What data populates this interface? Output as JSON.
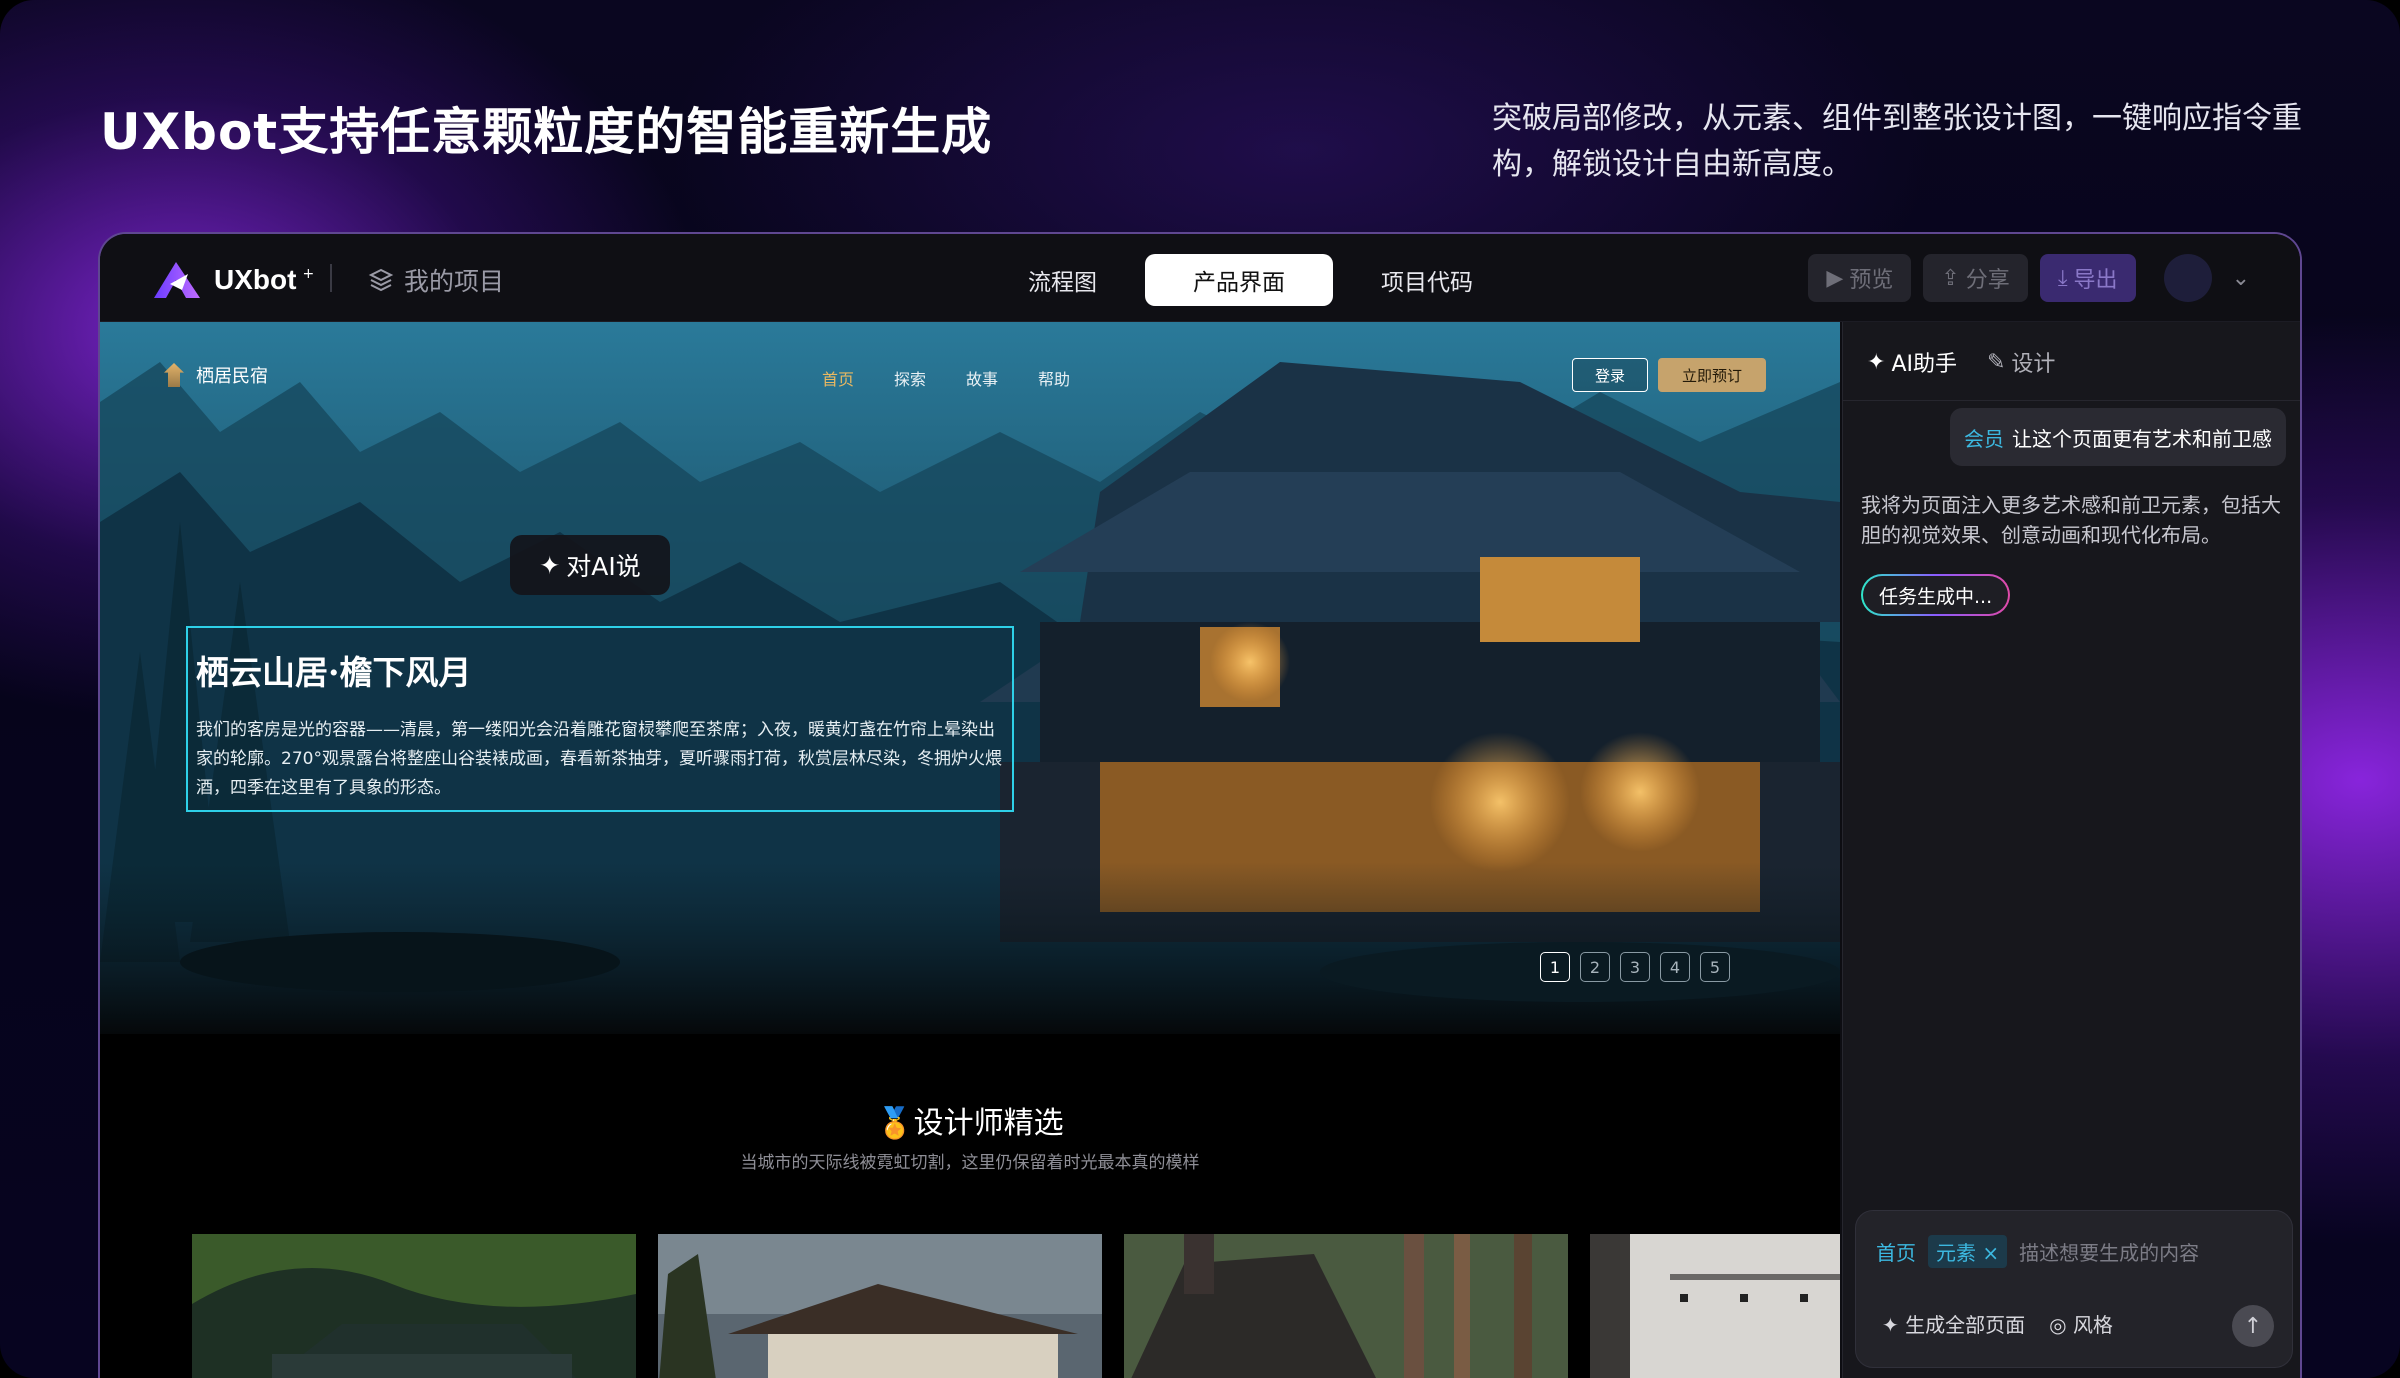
{
  "headline": "UXbot支持任意颗粒度的智能重新生成",
  "subline": "突破局部修改，从元素、组件到整张设计图，一键响应指令重构，解锁设计自由新高度。",
  "app": {
    "logo_text": "UXbot",
    "logo_sup": "+",
    "my_projects": "我的项目",
    "tabs": [
      "流程图",
      "产品界面",
      "项目代码"
    ],
    "active_tab": "产品界面",
    "actions": {
      "preview": "预览",
      "share": "分享",
      "export": "导出"
    }
  },
  "site": {
    "brand": "栖居民宿",
    "nav": [
      "首页",
      "探索",
      "故事",
      "帮助"
    ],
    "login": "登录",
    "book": "立即预订",
    "ai_say": "对AI说",
    "hero_title": "栖云山居·檐下风月",
    "hero_body": "我们的客房是光的容器——清晨，第一缕阳光会沿着雕花窗棂攀爬至茶席；入夜，暖黄灯盏在竹帘上晕染出家的轮廓。270°观景露台将整座山谷装裱成画，春看新茶抽芽，夏听骤雨打荷，秋赏层林尽染，冬拥炉火煨酒，四季在这里有了具象的形态。",
    "pager": [
      "1",
      "2",
      "3",
      "4",
      "5"
    ],
    "active_page": "1",
    "section_title": "设计师精选",
    "section_sub": "当城市的天际线被霓虹切割，这里仍保留着时光最本真的模样"
  },
  "panel": {
    "tabs": [
      "AI助手",
      "设计"
    ],
    "user_tag": "会员",
    "user_msg": "让这个页面更有艺术和前卫感",
    "bot_msg": "我将为页面注入更多艺术感和前卫元素，包括大胆的视觉效果、创意动画和现代化布局。",
    "task": "任务生成中...",
    "composer": {
      "chip_page": "首页",
      "chip_element": "元素",
      "placeholder": "描述想要生成的内容",
      "gen_all": "生成全部页面",
      "style": "风格"
    }
  },
  "colors": {
    "accent": "#7a4cff",
    "selection": "#2ed0e8",
    "gold": "#c6a36c"
  }
}
